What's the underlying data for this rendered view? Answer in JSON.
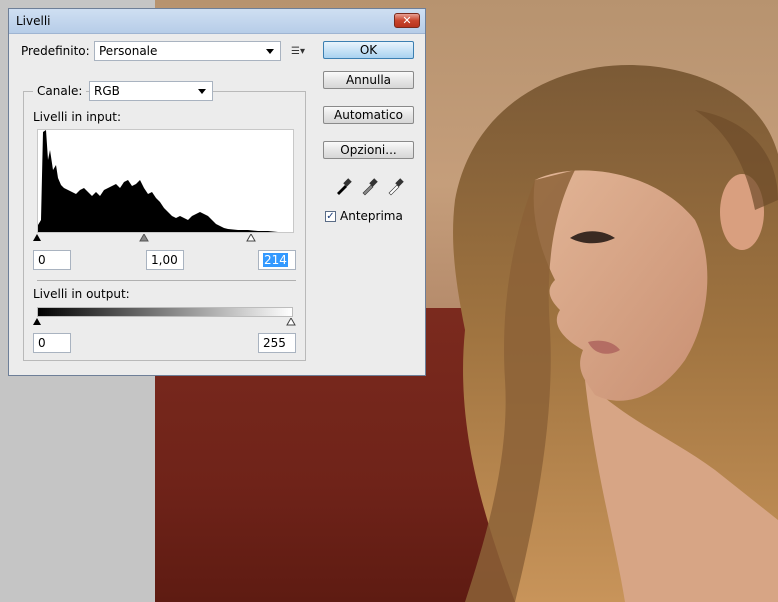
{
  "dialog": {
    "title": "Livelli",
    "close_icon": "close-icon",
    "preset_label": "Predefinito:",
    "preset_value": "Personale",
    "channel_label": "Canale:",
    "channel_value": "RGB",
    "input_levels_label": "Livelli in input:",
    "input_black": "0",
    "input_gamma": "1,00",
    "input_white": "214",
    "output_levels_label": "Livelli in output:",
    "output_black": "0",
    "output_white": "255",
    "buttons": {
      "ok": "OK",
      "cancel": "Annulla",
      "auto": "Automatico",
      "options": "Opzioni..."
    },
    "preview_label": "Anteprima",
    "preview_checked": true,
    "icons": [
      "preset-menu-icon",
      "black-eyedropper-icon",
      "gray-eyedropper-icon",
      "white-eyedropper-icon"
    ]
  }
}
